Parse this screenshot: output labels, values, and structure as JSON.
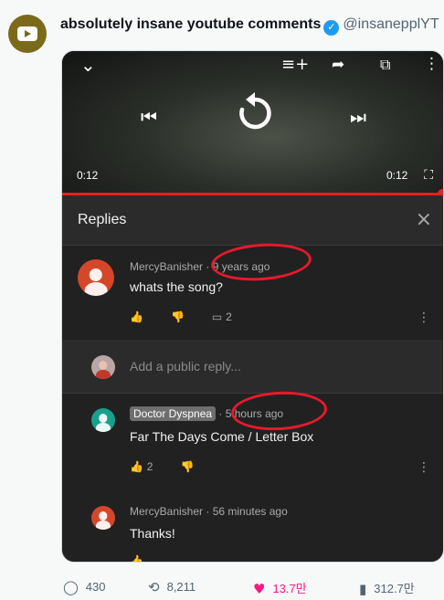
{
  "tweet": {
    "author_name": "absolutely insane youtube comments",
    "handle": "@insanepplYT"
  },
  "video": {
    "time_current": "0:12",
    "time_total": "0:12",
    "progress": 1.0
  },
  "replies_panel": {
    "title": "Replies",
    "close_icon": "×"
  },
  "comments": [
    {
      "author": "MercyBanisher",
      "age": "9 years ago",
      "text": "whats the song?",
      "reply_count": "2",
      "avatar_color": "#d4472b"
    },
    {
      "author": "Doctor Dyspnea",
      "age": "5 hours ago",
      "text": "Far The Days Come / Letter Box",
      "like_count": "2",
      "avatar_color": "#17a08d"
    },
    {
      "author": "MercyBanisher",
      "age": "56 minutes ago",
      "text": "Thanks!",
      "avatar_color": "#d4472b"
    }
  ],
  "reply_input": {
    "placeholder": "Add a public reply..."
  },
  "stats": {
    "replies": "430",
    "retweets": "8,211",
    "likes": "13.7만",
    "views": "312.7만"
  },
  "colors": {
    "highlight_circle": "#e8192c",
    "like": "#f91880",
    "progress": "#e52020"
  }
}
